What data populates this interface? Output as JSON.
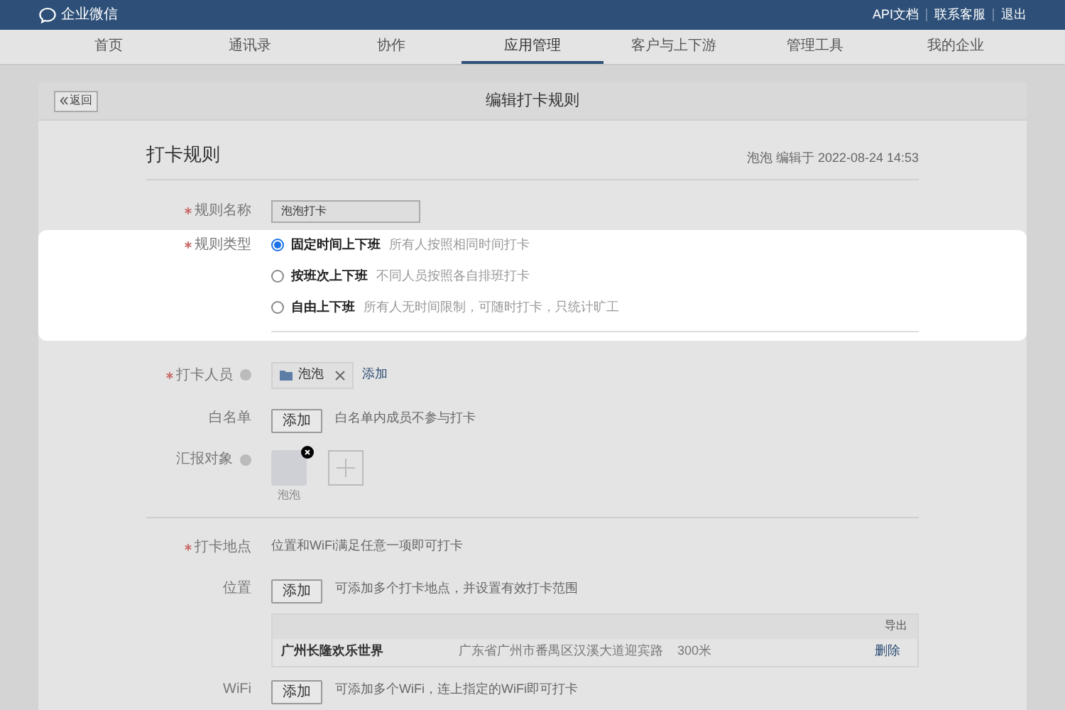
{
  "header": {
    "logo_text": "企业微信",
    "links": [
      "API文档",
      "联系客服",
      "退出"
    ]
  },
  "nav": [
    {
      "label": "首页",
      "selected": false
    },
    {
      "label": "通讯录",
      "selected": false
    },
    {
      "label": "协作",
      "selected": false
    },
    {
      "label": "应用管理",
      "selected": true
    },
    {
      "label": "客户与上下游",
      "selected": false
    },
    {
      "label": "管理工具",
      "selected": false
    },
    {
      "label": "我的企业",
      "selected": false
    }
  ],
  "page": {
    "back_button": "返回",
    "title": "编辑打卡规则"
  },
  "section": {
    "title": "打卡规则",
    "meta": "泡泡 编辑于 2022-08-24 14:53"
  },
  "rule_name": {
    "label": "规则名称",
    "required": true,
    "value": "泡泡打卡"
  },
  "rule_type": {
    "label": "规则类型",
    "required": true,
    "options": [
      {
        "label": "固定时间上下班",
        "description": "所有人按照相同时间打卡",
        "selected": true
      },
      {
        "label": "按班次上下班",
        "description": "不同人员按照各自排班打卡",
        "selected": false
      },
      {
        "label": "自由上下班",
        "description": "所有人无时间限制，可随时打卡，只统计旷工",
        "selected": false
      }
    ]
  },
  "members": {
    "label": "打卡人员",
    "required": true,
    "tag": "泡泡",
    "add_link": "添加"
  },
  "whitelist": {
    "label": "白名单",
    "required": false,
    "button": "添加",
    "hint": "白名单内成员不参与打卡"
  },
  "report": {
    "label": "汇报对象",
    "required": false,
    "person_name": "泡泡"
  },
  "location": {
    "label": "打卡地点",
    "required": true,
    "hint": "位置和WiFi满足任意一项即可打卡"
  },
  "position": {
    "label": "位置",
    "required": false,
    "button": "添加",
    "hint": "可添加多个打卡地点，并设置有效打卡范围",
    "table": {
      "export": "导出",
      "rows": [
        {
          "name": "广州长隆欢乐世界",
          "address": "广东省广州市番禺区汉溪大道迎宾路",
          "range": "300米",
          "action": "删除"
        }
      ]
    }
  },
  "wifi": {
    "label": "WiFi",
    "required": false,
    "button": "添加",
    "hint": "可添加多个WiFi，连上指定的WiFi即可打卡"
  }
}
